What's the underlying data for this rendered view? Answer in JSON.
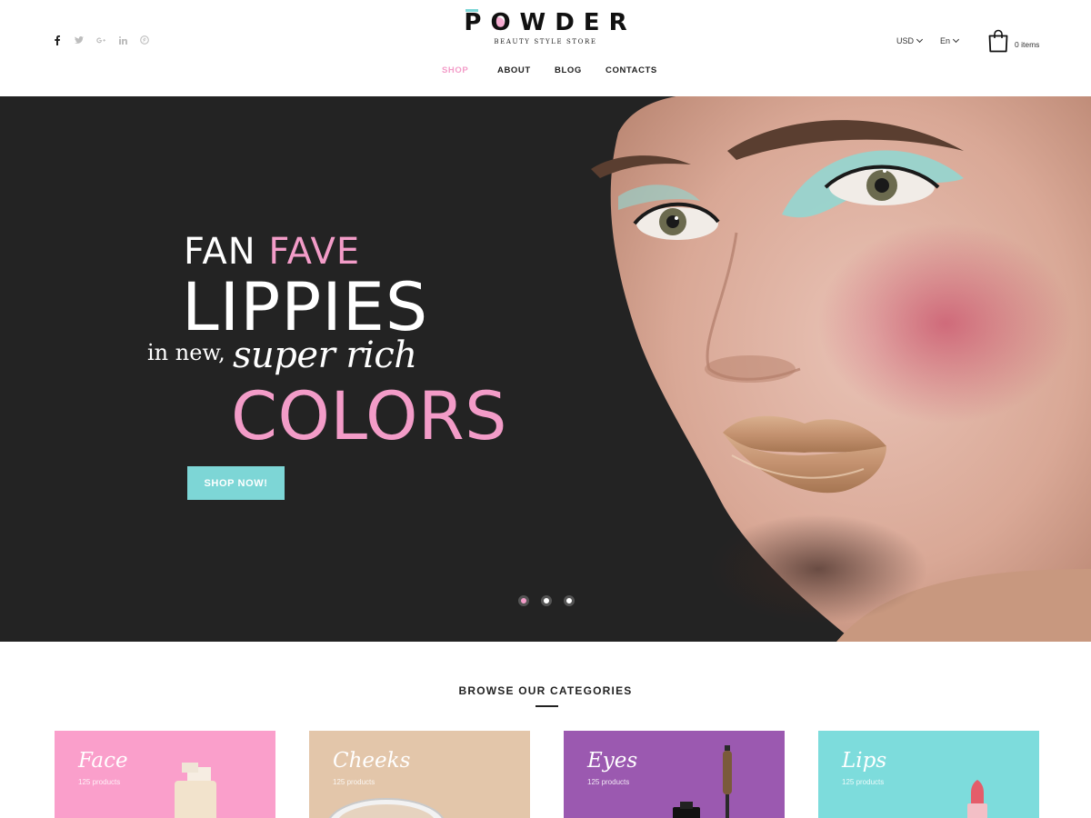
{
  "header": {
    "social": [
      "facebook-icon",
      "twitter-icon",
      "google-plus-icon",
      "linkedin-icon",
      "pinterest-icon"
    ],
    "logo": {
      "word": "POWDER",
      "tagline": "BEAUTY STYLE STORE"
    },
    "nav": [
      {
        "label": "SHOP",
        "active": true
      },
      {
        "label": "ABOUT",
        "active": false
      },
      {
        "label": "BLOG",
        "active": false
      },
      {
        "label": "CONTACTS",
        "active": false
      }
    ],
    "currency": "USD",
    "language": "En",
    "cart": {
      "label": "0 items",
      "icon": "shopping-bag-icon"
    }
  },
  "hero": {
    "line1_white": "FAN",
    "line1_pink": "FAVE",
    "line2": "LIPPIES",
    "line3_prefix": "in new,",
    "line3_script": "super rich",
    "line4": "COLORS",
    "button": "SHOP NOW!",
    "slides": 3,
    "active_slide": 1
  },
  "categories": {
    "heading": "BROWSE OUR CATEGORIES",
    "items": [
      {
        "title": "Face",
        "count": "125 products",
        "color": "#fa9fcb"
      },
      {
        "title": "Cheeks",
        "count": "125 products",
        "color": "#e3c6aa"
      },
      {
        "title": "Eyes",
        "count": "125 products",
        "color": "#9b59b0"
      },
      {
        "title": "Lips",
        "count": "125 products",
        "color": "#7ddcdc"
      }
    ]
  },
  "colors": {
    "accent_pink": "#f39cc8",
    "accent_teal": "#7dd6d6",
    "hero_bg": "#232323"
  }
}
